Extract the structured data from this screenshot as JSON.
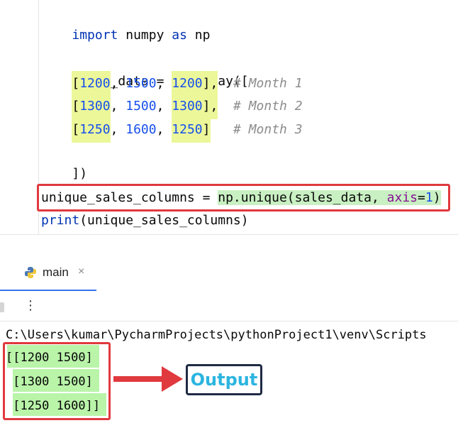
{
  "editor": {
    "line1": {
      "kw_import": "import",
      "mod": " numpy ",
      "kw_as": "as",
      "alias": " np"
    },
    "line2": {
      "text": "sales_data = np.array(["
    },
    "rows": [
      {
        "open": "[",
        "a": "1200",
        "b": "1500",
        "c": "1200",
        "close": "],",
        "comment": "# Month 1"
      },
      {
        "open": "[",
        "a": "1300",
        "b": "1500",
        "c": "1300",
        "close": "],",
        "comment": "# Month 2"
      },
      {
        "open": "[",
        "a": "1250",
        "b": "1600",
        "c": "1250",
        "close": "]",
        "comment": "# Month 3"
      }
    ],
    "close_bracket": "])",
    "unique_line": {
      "lhs": "unique_sales_columns = ",
      "call": "np.unique(sales_data, ",
      "kw": "axis",
      "eq": "=",
      "val": "1",
      "end": ")"
    },
    "print_line": {
      "func": "print",
      "args": "(unique_sales_columns)"
    }
  },
  "run_panel": {
    "tab_label": "main",
    "tab_close": "×",
    "more_icon": "⋮",
    "path": "C:\\Users\\kumar\\PycharmProjects\\pythonProject1\\venv\\Scripts",
    "output_lines": [
      "[[1200 1500]",
      " [1300 1500]",
      " [1250 1600]]"
    ]
  },
  "annotation": {
    "label": "Output"
  },
  "colors": {
    "highlight_yellow": "#ecf79a",
    "highlight_green": "#c9f0c3",
    "red_box": "#e0393e",
    "output_bg": "#b9f4a9",
    "badge_text": "#2bb5e0"
  }
}
